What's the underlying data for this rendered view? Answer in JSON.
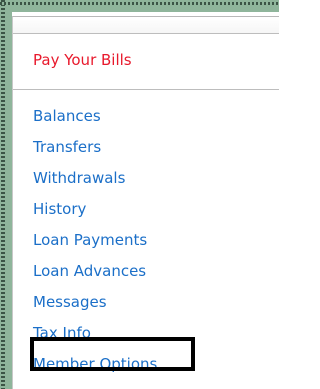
{
  "menu": {
    "header_link": "Pay Your Bills",
    "items": [
      "Balances",
      "Transfers",
      "Withdrawals",
      "History",
      "Loan Payments",
      "Loan Advances",
      "Messages",
      "Tax Info",
      "Member Options"
    ],
    "highlighted_item": "Tax Info"
  },
  "colors": {
    "frame_green": "#8fb59b",
    "header_link_red": "#e8192c",
    "nav_link_blue": "#1b6fc8",
    "highlight_box": "#000000"
  }
}
